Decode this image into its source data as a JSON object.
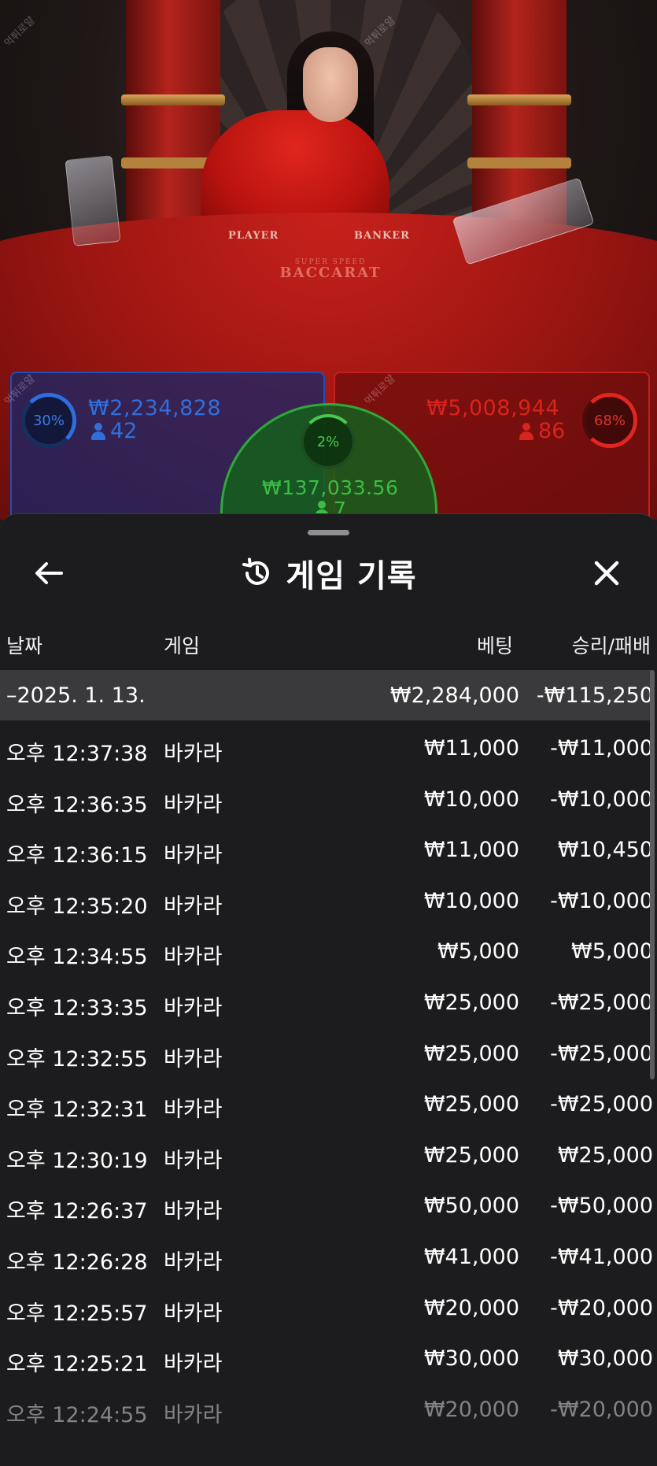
{
  "table": {
    "label_player": "PLAYER",
    "label_banker": "BANKER",
    "brand_small": "SUPER SPEED",
    "brand_big": "BACCARAT",
    "player": {
      "percent": "30%",
      "amount": "₩2,234,828",
      "count": "42",
      "color": "#2f6fdc"
    },
    "banker": {
      "percent": "68%",
      "amount": "₩5,008,944",
      "count": "86",
      "color": "#d9241d"
    },
    "tie": {
      "percent": "2%",
      "amount": "₩137,033.56",
      "count": "7",
      "color": "#3dbd45"
    },
    "watermark": "먹튀로얄"
  },
  "sheet": {
    "title": "게임 기록",
    "columns": {
      "date": "날짜",
      "game": "게임",
      "bet": "베팅",
      "result": "승리/패배"
    },
    "date_group": {
      "date": "–2025. 1. 13.",
      "bet": "₩2,284,000",
      "result": "-₩115,250"
    },
    "rows": [
      {
        "time": "오후 12:37:38",
        "game": "바카라",
        "bet": "₩11,000",
        "result": "-₩11,000"
      },
      {
        "time": "오후 12:36:35",
        "game": "바카라",
        "bet": "₩10,000",
        "result": "-₩10,000"
      },
      {
        "time": "오후 12:36:15",
        "game": "바카라",
        "bet": "₩11,000",
        "result": "₩10,450"
      },
      {
        "time": "오후 12:35:20",
        "game": "바카라",
        "bet": "₩10,000",
        "result": "-₩10,000"
      },
      {
        "time": "오후 12:34:55",
        "game": "바카라",
        "bet": "₩5,000",
        "result": "₩5,000"
      },
      {
        "time": "오후 12:33:35",
        "game": "바카라",
        "bet": "₩25,000",
        "result": "-₩25,000"
      },
      {
        "time": "오후 12:32:55",
        "game": "바카라",
        "bet": "₩25,000",
        "result": "-₩25,000"
      },
      {
        "time": "오후 12:32:31",
        "game": "바카라",
        "bet": "₩25,000",
        "result": "-₩25,000"
      },
      {
        "time": "오후 12:30:19",
        "game": "바카라",
        "bet": "₩25,000",
        "result": "₩25,000"
      },
      {
        "time": "오후 12:26:37",
        "game": "바카라",
        "bet": "₩50,000",
        "result": "-₩50,000"
      },
      {
        "time": "오후 12:26:28",
        "game": "바카라",
        "bet": "₩41,000",
        "result": "-₩41,000"
      },
      {
        "time": "오후 12:25:57",
        "game": "바카라",
        "bet": "₩20,000",
        "result": "-₩20,000"
      },
      {
        "time": "오후 12:25:21",
        "game": "바카라",
        "bet": "₩30,000",
        "result": "₩30,000"
      },
      {
        "time": "오후 12:24:55",
        "game": "바카라",
        "bet": "₩20,000",
        "result": "-₩20,000"
      }
    ],
    "icons": {
      "back": "arrow-left-icon",
      "history": "history-icon",
      "close": "close-icon"
    }
  }
}
